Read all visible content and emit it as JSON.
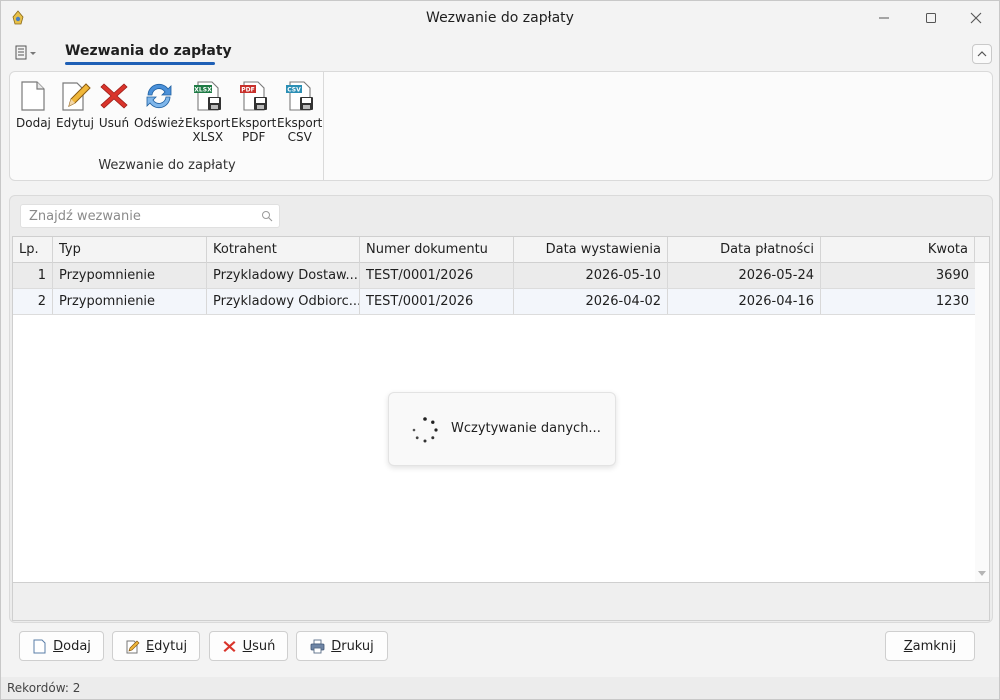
{
  "window": {
    "title": "Wezwanie do zapłaty",
    "controls": [
      "minimize-icon",
      "maximize-icon",
      "close-icon"
    ]
  },
  "ribbon": {
    "tab_label": "Wezwania do zapłaty",
    "group_label": "Wezwanie do zapłaty",
    "buttons": [
      {
        "label": "Dodaj",
        "icon": "new-document-icon"
      },
      {
        "label": "Edytuj",
        "icon": "edit-document-icon"
      },
      {
        "label": "Usuń",
        "icon": "delete-x-icon"
      },
      {
        "label": "Odśwież",
        "icon": "refresh-icon"
      },
      {
        "label": "Eksport XLSX",
        "line1": "Eksport",
        "line2": "XLSX",
        "badge": "XLSX",
        "icon": "export-xlsx-icon"
      },
      {
        "label": "Eksport PDF",
        "line1": "Eksport",
        "line2": "PDF",
        "badge": "PDF",
        "icon": "export-pdf-icon"
      },
      {
        "label": "Eksport CSV",
        "line1": "Eksport",
        "line2": "CSV",
        "badge": "CSV",
        "icon": "export-csv-icon"
      }
    ]
  },
  "search": {
    "placeholder": "Znajdź wezwanie",
    "value": ""
  },
  "table": {
    "columns": [
      "Lp.",
      "Typ",
      "Kotrahent",
      "Numer dokumentu",
      "Data wystawienia",
      "Data płatności",
      "Kwota"
    ],
    "rows": [
      [
        "1",
        "Przypomnienie",
        "Przykladowy Dostaw...",
        "TEST/0001/2026",
        "2026-05-10",
        "2026-05-24",
        "3690"
      ],
      [
        "2",
        "Przypomnienie",
        "Przykladowy Odbiorc...",
        "TEST/0001/2026",
        "2026-04-02",
        "2026-04-16",
        "1230"
      ]
    ]
  },
  "loading": {
    "text": "Wczytywanie danych..."
  },
  "actions": {
    "add": {
      "first": "D",
      "rest": "odaj"
    },
    "edit": {
      "first": "E",
      "rest": "dytuj"
    },
    "delete": {
      "first": "U",
      "rest": "suń"
    },
    "print": {
      "first": "D",
      "rest": "rukuj"
    },
    "close": {
      "first": "Z",
      "rest": "amknij"
    }
  },
  "status": {
    "records": "Rekordów: 2"
  },
  "colors": {
    "accent": "#1e5fb5",
    "delete_red": "#d9342b",
    "xlsx_green": "#1e7b45",
    "pdf_red": "#c8302b",
    "csv_teal": "#2b8fb5"
  }
}
